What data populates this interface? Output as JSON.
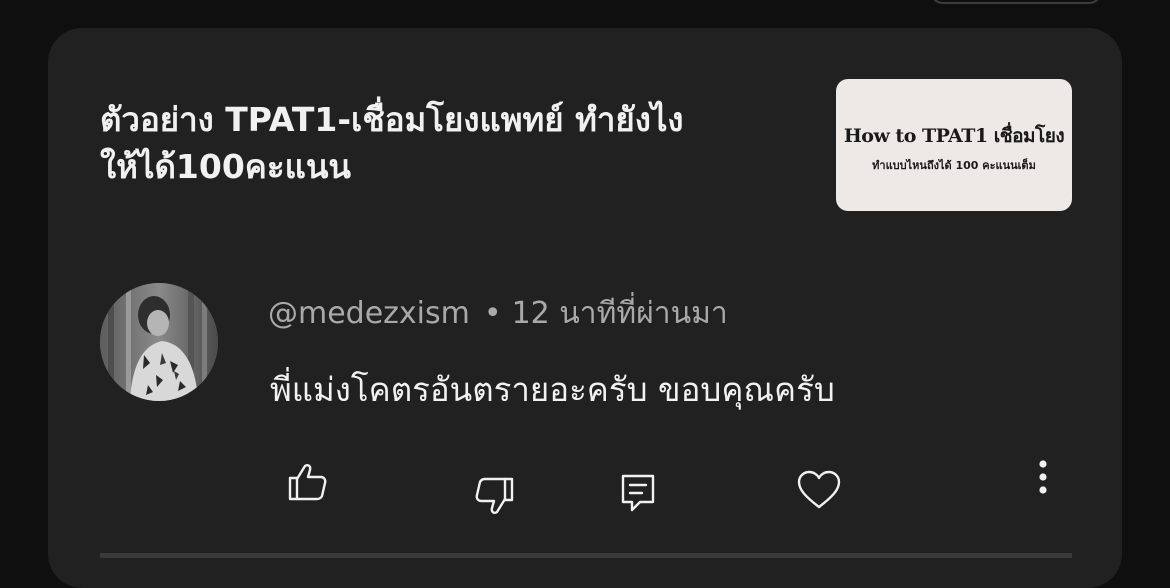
{
  "video": {
    "title_line1": "ตัวอย่าง TPAT1-เชื่อมโยงแพทย์ ทำยังไง",
    "title_line2": "ให้ได้100คะแนน",
    "thumbnail": {
      "title": "How to TPAT1 เชื่อมโยง",
      "subtitle": "ทำแบบไหนถึงได้ 100 คะแนนเต็ม"
    }
  },
  "comment": {
    "author": "@medezxism",
    "separator": "•",
    "time": "12 นาทีที่ผ่านมา",
    "text": "พี่แม่งโคตรอันตรายอะครับ ขอบคุณครับ"
  },
  "actions": {
    "like_icon": "thumbs-up-icon",
    "dislike_icon": "thumbs-down-icon",
    "reply_icon": "comment-reply-icon",
    "heart_icon": "heart-icon",
    "more_icon": "more-vert-icon"
  },
  "colors": {
    "background": "#0f0f0f",
    "card": "#212121",
    "text_primary": "#f1f1f1",
    "text_secondary": "#a9a9a9"
  }
}
